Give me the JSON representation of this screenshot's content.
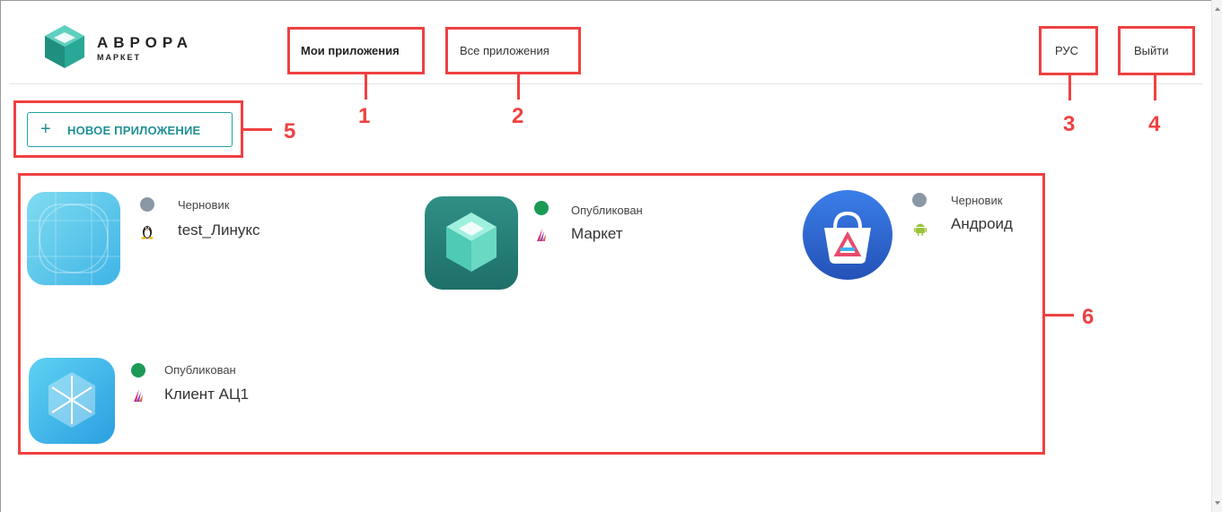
{
  "header": {
    "logo": {
      "title": "АВРОРА",
      "subtitle": "МАРКЕТ"
    },
    "nav": {
      "my_apps": "Мои приложения",
      "all_apps": "Все приложения",
      "language": "РУС",
      "logout": "Выйти"
    }
  },
  "toolbar": {
    "new_app_icon": "+",
    "new_app_label": "НОВОЕ ПРИЛОЖЕНИЕ"
  },
  "apps": [
    {
      "name": "test_Линукс",
      "status": "Черновик",
      "status_color": "#8a98a6",
      "platform": "linux-icon"
    },
    {
      "name": "Маркет",
      "status": "Опубликован",
      "status_color": "#1a9a55",
      "platform": "aurora-icon"
    },
    {
      "name": "Андроид",
      "status": "Черновик",
      "status_color": "#8a98a6",
      "platform": "android-icon"
    },
    {
      "name": "Клиент АЦ1",
      "status": "Опубликован",
      "status_color": "#1a9a55",
      "platform": "aurora-icon"
    }
  ],
  "annotations": [
    "1",
    "2",
    "3",
    "4",
    "5",
    "6"
  ],
  "colors": {
    "callout": "#ef4141",
    "accent": "#1e8f95",
    "draft": "#8a98a6",
    "published": "#1a9a55"
  }
}
